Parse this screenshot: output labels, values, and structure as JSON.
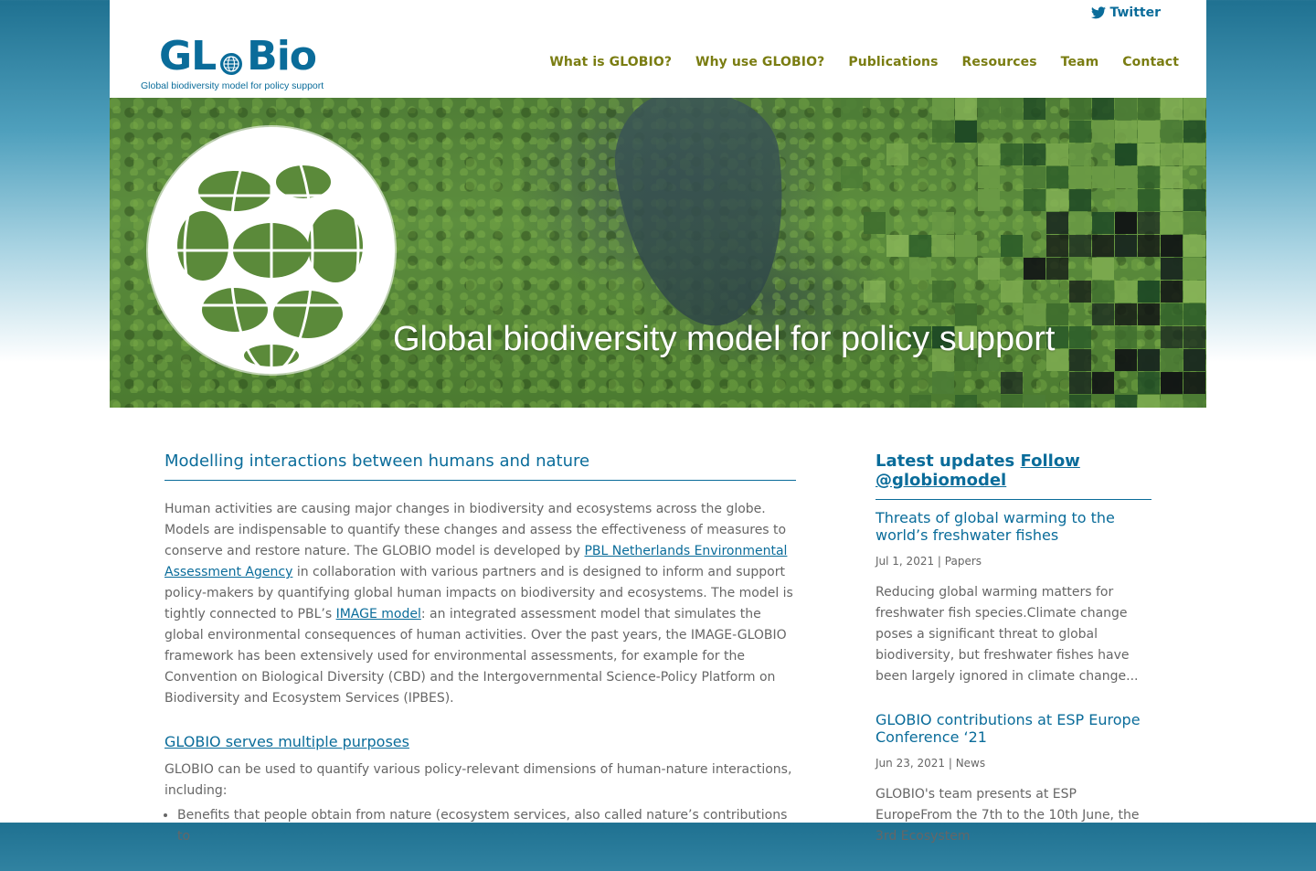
{
  "header": {
    "twitter_label": "Twitter",
    "logo_text_left": "GL",
    "logo_text_right": "Bio",
    "logo_tagline": "Global biodiversity model for policy support",
    "nav": [
      {
        "label": "What is GLOBIO?"
      },
      {
        "label": "Why use GLOBIO?"
      },
      {
        "label": "Publications"
      },
      {
        "label": "Resources"
      },
      {
        "label": "Team"
      },
      {
        "label": "Contact"
      }
    ]
  },
  "banner": {
    "title": "Global biodiversity model for policy support"
  },
  "main": {
    "section_title": "Modelling interactions between humans and nature",
    "p1_a": "Human activities are causing major changes in biodiversity and ecosystems across the globe. Models are indispensable to quantify these changes and assess the effectiveness of measures to conserve and restore nature. The GLOBIO model is developed by ",
    "p1_link1": "PBL Netherlands Environmental Assessment Agency",
    "p1_b": " in collaboration with various partners and is designed to inform and support policy-makers by quantifying global human impacts on biodiversity and ecosystems. The model is tightly connected to PBL’s ",
    "p1_link2": "IMAGE model",
    "p1_c": ": an integrated assessment model that simulates the global environmental consequences of human activities. Over the past years, the IMAGE-GLOBIO framework has been extensively used for environmental assessments, for example for the Convention on Biological Diversity (CBD) and the Intergovernmental Science-Policy Platform on Biodiversity and Ecosystem Services (IPBES).",
    "purposes_title": "GLOBIO serves multiple purposes",
    "purposes_intro": "GLOBIO can be used to quantify various policy-relevant dimensions of human-nature interactions, including:",
    "bullets": [
      "Benefits that people obtain from nature (ecosystem services, also called nature’s contributions to"
    ]
  },
  "sidebar": {
    "title": "Latest updates ",
    "follow_link": "Follow @globiomodel",
    "posts": [
      {
        "title": "Threats of global warming to the world’s freshwater fishes",
        "date": "Jul 1, 2021",
        "sep": " | ",
        "category": "Papers",
        "excerpt": "Reducing global warming matters for freshwater fish species.Climate change poses a significant threat to global biodiversity, but freshwater fishes have been largely ignored in climate change..."
      },
      {
        "title": "GLOBIO contributions at ESP Europe Conference ‘21",
        "date": "Jun 23, 2021",
        "sep": " | ",
        "category": "News",
        "excerpt": "GLOBIO's team presents at ESP EuropeFrom the 7th to the 10th June, the 3rd Ecosystem"
      }
    ]
  },
  "colors": {
    "brand_blue": "#0a6c9a",
    "nav_olive": "#7a7d12",
    "text_gray": "#666666"
  }
}
